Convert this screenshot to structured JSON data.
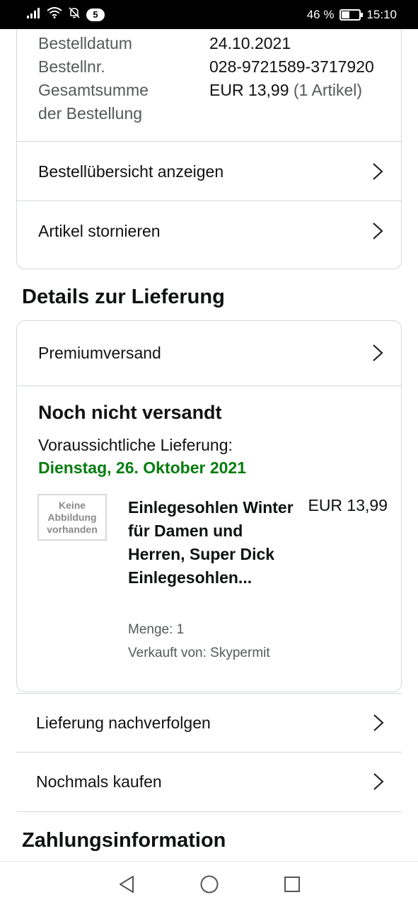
{
  "status_bar": {
    "notification_count": "5",
    "battery_percent_text": "46 %",
    "battery_level": 0.46,
    "time": "15:10"
  },
  "order_summary": {
    "order_date_label": "Bestelldatum",
    "order_date_value": "24.10.2021",
    "order_number_label": "Bestellnr.",
    "order_number_value": "028-9721589-3717920",
    "total_label_line1": "Gesamtsumme",
    "total_label_line2": "der Bestellung",
    "total_value": "EUR 13,99",
    "total_items": "(1 Artikel)",
    "actions": [
      {
        "label": "Bestellübersicht anzeigen"
      },
      {
        "label": "Artikel stornieren"
      }
    ]
  },
  "delivery": {
    "section_title": "Details zur Lieferung",
    "shipping_method": "Premiumversand",
    "status": "Noch nicht versandt",
    "estimate_label": "Voraussichtliche Lieferung:",
    "estimate_date": "Dienstag, 26. Oktober 2021",
    "item": {
      "no_image_line1": "Keine",
      "no_image_line2": "Abbildung",
      "no_image_line3": "vorhanden",
      "title": "Einlegesohlen Winter für Damen und Herren, Super Dick Einlegesohlen...",
      "price": "EUR 13,99",
      "quantity": "Menge: 1",
      "seller": "Verkauft von: Skypermit"
    },
    "actions": [
      {
        "label": "Lieferung nachverfolgen"
      },
      {
        "label": "Nochmals kaufen"
      }
    ]
  },
  "payment": {
    "section_title": "Zahlungsinformation"
  },
  "colors": {
    "delivery_date_green": "#067d0e",
    "border": "#d5d9d9",
    "muted_text": "#565959"
  }
}
